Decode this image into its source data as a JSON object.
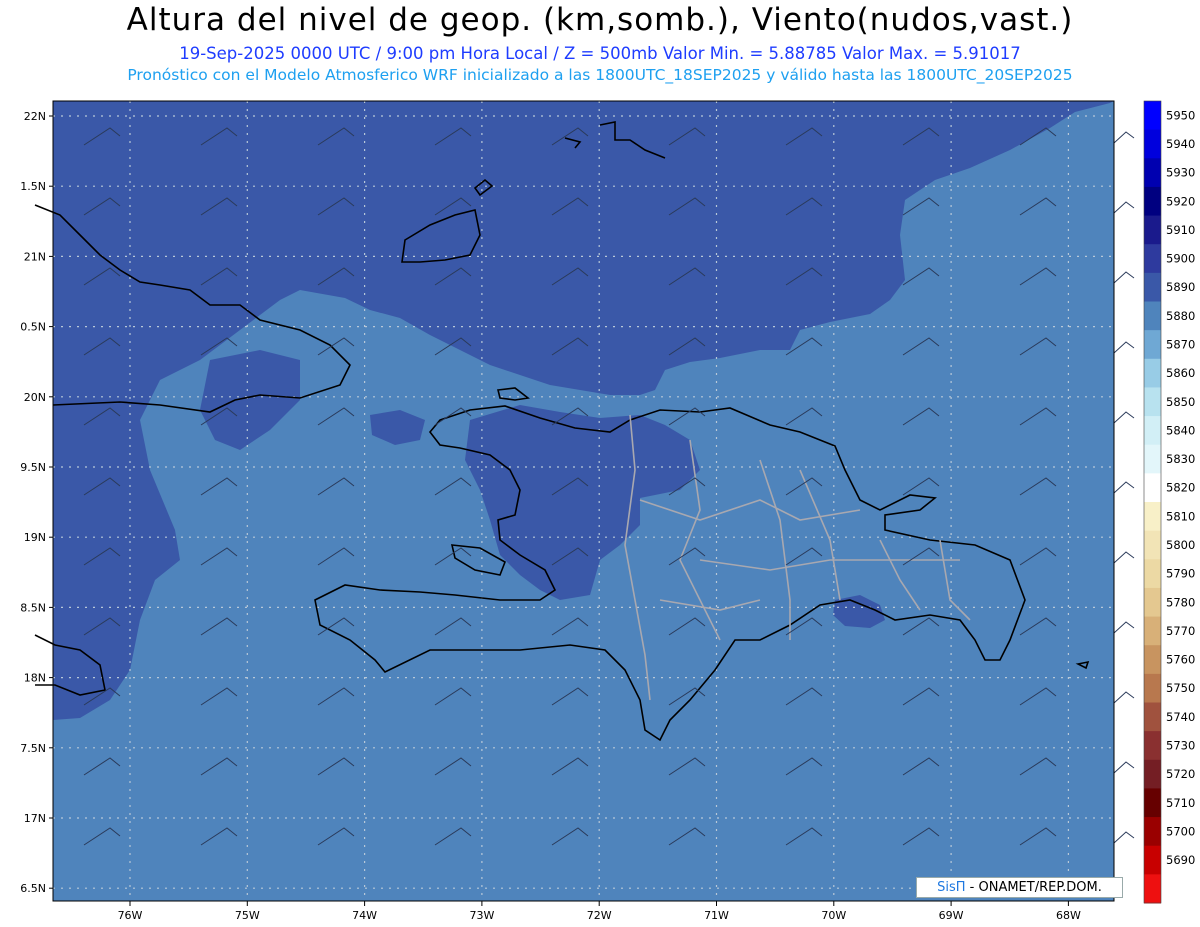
{
  "header": {
    "title": "Altura del nivel de geop. (km,somb.), Viento(nudos,vast.)",
    "subtitle1": "19-Sep-2025  0000 UTC / 9:00 pm Hora Local / Z = 500mb     Valor Min. = 5.88785  Valor Max. = 5.91017",
    "subtitle2": "Pronóstico con el Modelo Atmosferico WRF inicializado a las 1800UTC_18SEP2025 y válido hasta las  1800UTC_20SEP2025"
  },
  "axes": {
    "lat_labels": [
      "22N",
      "1.5N",
      "21N",
      "0.5N",
      "20N",
      "9.5N",
      "19N",
      "8.5N",
      "18N",
      "7.5N",
      "17N",
      "6.5N"
    ],
    "lon_labels": [
      "76W",
      "75W",
      "74W",
      "73W",
      "72W",
      "71W",
      "70W",
      "69W",
      "68W"
    ]
  },
  "colorbar": {
    "labels": [
      "5950",
      "5940",
      "5930",
      "5920",
      "5910",
      "5900",
      "5890",
      "5880",
      "5870",
      "5860",
      "5850",
      "5840",
      "5830",
      "5820",
      "5810",
      "5800",
      "5790",
      "5780",
      "5770",
      "5760",
      "5750",
      "5740",
      "5730",
      "5720",
      "5710",
      "5700",
      "5690"
    ],
    "colors": [
      "#0000ff",
      "#0000dd",
      "#0000b0",
      "#000080",
      "#1a1a8c",
      "#2e3a9e",
      "#3a58a8",
      "#4f84bc",
      "#6fa8d4",
      "#98cce6",
      "#b8e2ef",
      "#d2eff6",
      "#e3f6fa",
      "#ffffff",
      "#f8f0c8",
      "#f2e4b6",
      "#ecd9a4",
      "#e4c890",
      "#d8b078",
      "#c89460",
      "#b8784e",
      "#a0523e",
      "#8a3030",
      "#741e24",
      "#660000",
      "#9a0000",
      "#c80000",
      "#ee1010"
    ],
    "dark_color": "#3a58a8",
    "light_color": "#4f84bc"
  },
  "credit": {
    "brand": "SisΠ",
    "org": "- ONAMET/REP.DOM."
  }
}
